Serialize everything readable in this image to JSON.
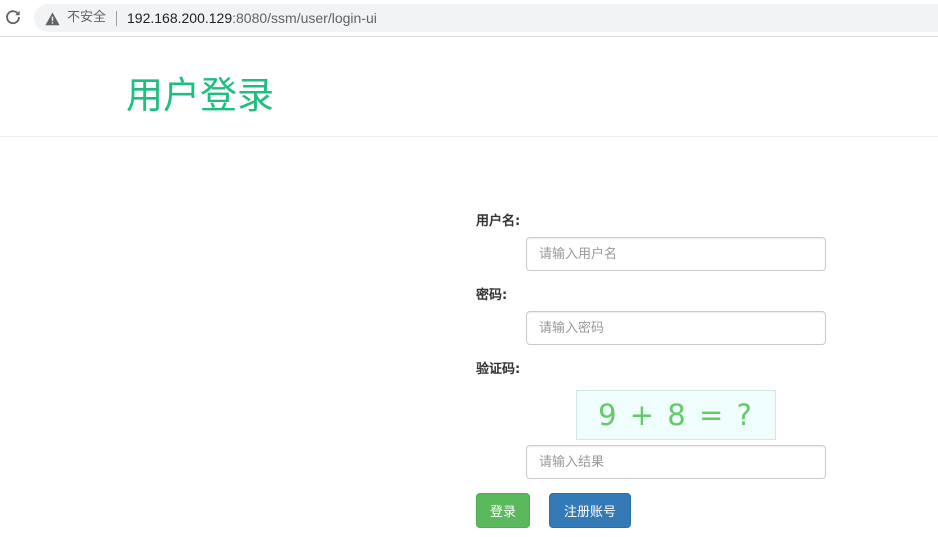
{
  "browser": {
    "security_label": "不安全",
    "url_host": "192.168.200.129",
    "url_rest": ":8080/ssm/user/login-ui"
  },
  "page": {
    "title": "用户登录"
  },
  "form": {
    "username_label": "用户名:",
    "username_placeholder": "请输入用户名",
    "password_label": "密码:",
    "password_placeholder": "请输入密码",
    "captcha_label": "验证码:",
    "captcha_text": "9 + 8 = ?",
    "captcha_placeholder": "请输入结果",
    "login_button": "登录",
    "register_button": "注册账号"
  }
}
